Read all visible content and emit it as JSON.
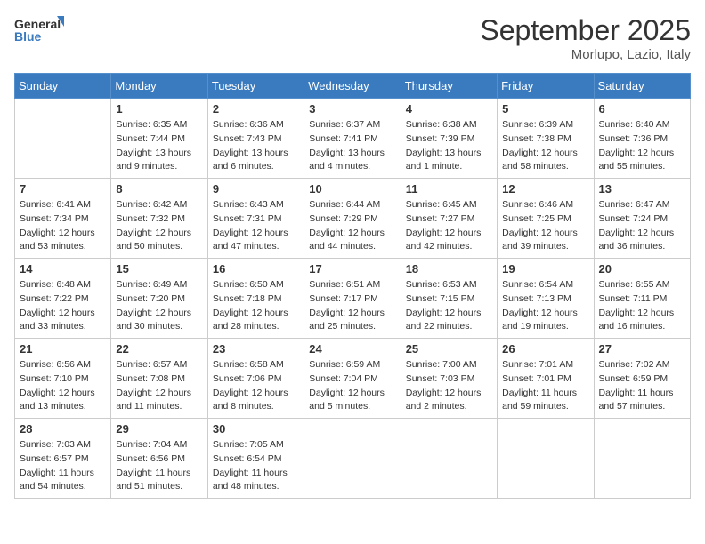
{
  "header": {
    "logo_general": "General",
    "logo_blue": "Blue",
    "month": "September 2025",
    "location": "Morlupo, Lazio, Italy"
  },
  "days_of_week": [
    "Sunday",
    "Monday",
    "Tuesday",
    "Wednesday",
    "Thursday",
    "Friday",
    "Saturday"
  ],
  "weeks": [
    [
      {
        "day": "",
        "content": ""
      },
      {
        "day": "1",
        "content": "Sunrise: 6:35 AM\nSunset: 7:44 PM\nDaylight: 13 hours\nand 9 minutes."
      },
      {
        "day": "2",
        "content": "Sunrise: 6:36 AM\nSunset: 7:43 PM\nDaylight: 13 hours\nand 6 minutes."
      },
      {
        "day": "3",
        "content": "Sunrise: 6:37 AM\nSunset: 7:41 PM\nDaylight: 13 hours\nand 4 minutes."
      },
      {
        "day": "4",
        "content": "Sunrise: 6:38 AM\nSunset: 7:39 PM\nDaylight: 13 hours\nand 1 minute."
      },
      {
        "day": "5",
        "content": "Sunrise: 6:39 AM\nSunset: 7:38 PM\nDaylight: 12 hours\nand 58 minutes."
      },
      {
        "day": "6",
        "content": "Sunrise: 6:40 AM\nSunset: 7:36 PM\nDaylight: 12 hours\nand 55 minutes."
      }
    ],
    [
      {
        "day": "7",
        "content": "Sunrise: 6:41 AM\nSunset: 7:34 PM\nDaylight: 12 hours\nand 53 minutes."
      },
      {
        "day": "8",
        "content": "Sunrise: 6:42 AM\nSunset: 7:32 PM\nDaylight: 12 hours\nand 50 minutes."
      },
      {
        "day": "9",
        "content": "Sunrise: 6:43 AM\nSunset: 7:31 PM\nDaylight: 12 hours\nand 47 minutes."
      },
      {
        "day": "10",
        "content": "Sunrise: 6:44 AM\nSunset: 7:29 PM\nDaylight: 12 hours\nand 44 minutes."
      },
      {
        "day": "11",
        "content": "Sunrise: 6:45 AM\nSunset: 7:27 PM\nDaylight: 12 hours\nand 42 minutes."
      },
      {
        "day": "12",
        "content": "Sunrise: 6:46 AM\nSunset: 7:25 PM\nDaylight: 12 hours\nand 39 minutes."
      },
      {
        "day": "13",
        "content": "Sunrise: 6:47 AM\nSunset: 7:24 PM\nDaylight: 12 hours\nand 36 minutes."
      }
    ],
    [
      {
        "day": "14",
        "content": "Sunrise: 6:48 AM\nSunset: 7:22 PM\nDaylight: 12 hours\nand 33 minutes."
      },
      {
        "day": "15",
        "content": "Sunrise: 6:49 AM\nSunset: 7:20 PM\nDaylight: 12 hours\nand 30 minutes."
      },
      {
        "day": "16",
        "content": "Sunrise: 6:50 AM\nSunset: 7:18 PM\nDaylight: 12 hours\nand 28 minutes."
      },
      {
        "day": "17",
        "content": "Sunrise: 6:51 AM\nSunset: 7:17 PM\nDaylight: 12 hours\nand 25 minutes."
      },
      {
        "day": "18",
        "content": "Sunrise: 6:53 AM\nSunset: 7:15 PM\nDaylight: 12 hours\nand 22 minutes."
      },
      {
        "day": "19",
        "content": "Sunrise: 6:54 AM\nSunset: 7:13 PM\nDaylight: 12 hours\nand 19 minutes."
      },
      {
        "day": "20",
        "content": "Sunrise: 6:55 AM\nSunset: 7:11 PM\nDaylight: 12 hours\nand 16 minutes."
      }
    ],
    [
      {
        "day": "21",
        "content": "Sunrise: 6:56 AM\nSunset: 7:10 PM\nDaylight: 12 hours\nand 13 minutes."
      },
      {
        "day": "22",
        "content": "Sunrise: 6:57 AM\nSunset: 7:08 PM\nDaylight: 12 hours\nand 11 minutes."
      },
      {
        "day": "23",
        "content": "Sunrise: 6:58 AM\nSunset: 7:06 PM\nDaylight: 12 hours\nand 8 minutes."
      },
      {
        "day": "24",
        "content": "Sunrise: 6:59 AM\nSunset: 7:04 PM\nDaylight: 12 hours\nand 5 minutes."
      },
      {
        "day": "25",
        "content": "Sunrise: 7:00 AM\nSunset: 7:03 PM\nDaylight: 12 hours\nand 2 minutes."
      },
      {
        "day": "26",
        "content": "Sunrise: 7:01 AM\nSunset: 7:01 PM\nDaylight: 11 hours\nand 59 minutes."
      },
      {
        "day": "27",
        "content": "Sunrise: 7:02 AM\nSunset: 6:59 PM\nDaylight: 11 hours\nand 57 minutes."
      }
    ],
    [
      {
        "day": "28",
        "content": "Sunrise: 7:03 AM\nSunset: 6:57 PM\nDaylight: 11 hours\nand 54 minutes."
      },
      {
        "day": "29",
        "content": "Sunrise: 7:04 AM\nSunset: 6:56 PM\nDaylight: 11 hours\nand 51 minutes."
      },
      {
        "day": "30",
        "content": "Sunrise: 7:05 AM\nSunset: 6:54 PM\nDaylight: 11 hours\nand 48 minutes."
      },
      {
        "day": "",
        "content": ""
      },
      {
        "day": "",
        "content": ""
      },
      {
        "day": "",
        "content": ""
      },
      {
        "day": "",
        "content": ""
      }
    ]
  ]
}
